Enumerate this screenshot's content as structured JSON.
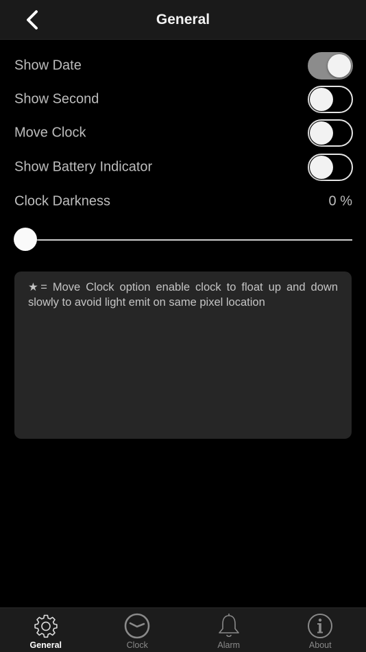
{
  "navbar": {
    "title": "General",
    "back_icon": "chevron-left-icon"
  },
  "settings": {
    "show_date": {
      "label": "Show Date",
      "enabled": true
    },
    "show_second": {
      "label": "Show Second",
      "enabled": false
    },
    "move_clock": {
      "label": "Move Clock",
      "enabled": false
    },
    "show_battery": {
      "label": "Show Battery Indicator",
      "enabled": false
    },
    "clock_darkness": {
      "label": "Clock Darkness",
      "value_text": "0 %",
      "value": 0
    }
  },
  "note": {
    "text": "★= Move Clock option enable clock to float up and down slowly to avoid light emit on same pixel location"
  },
  "tabs": [
    {
      "label": "General",
      "icon": "gear-icon",
      "active": true
    },
    {
      "label": "Clock",
      "icon": "clock-icon",
      "active": false
    },
    {
      "label": "Alarm",
      "icon": "bell-icon",
      "active": false
    },
    {
      "label": "About",
      "icon": "info-icon",
      "active": false
    }
  ],
  "colors": {
    "background": "#000000",
    "toggle_on": "#8c8c8c",
    "panel": "#262626",
    "active_tab": "#ffffff",
    "inactive_tab": "#8a8a8a"
  }
}
